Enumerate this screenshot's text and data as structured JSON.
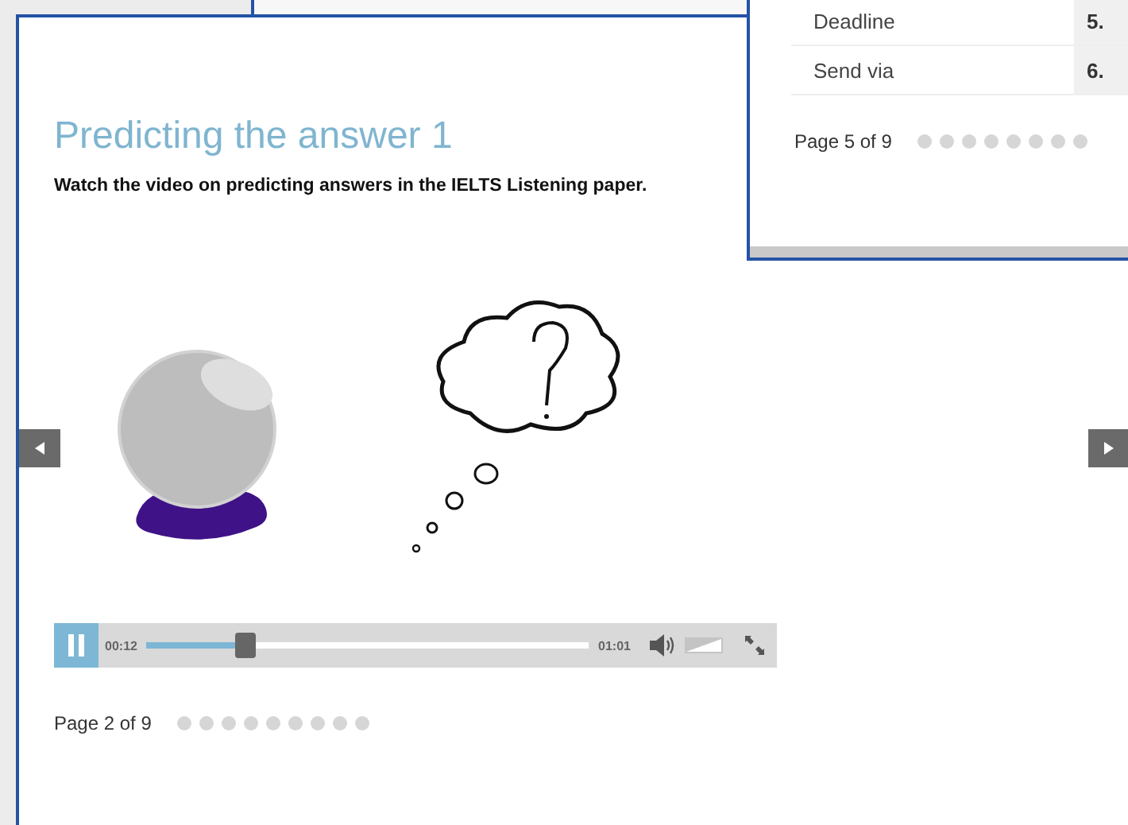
{
  "main_window": {
    "title": "Predicting the answer 1",
    "instruction": "Watch the video on predicting answers in the IELTS Listening paper.",
    "video": {
      "playing": true,
      "elapsed": "00:12",
      "duration": "01:01",
      "level": 0.22,
      "volume": {
        "level": 1
      }
    },
    "page_indicator": "Page 2 of 9"
  },
  "side_window": {
    "rows": [
      {
        "label": "Deadline",
        "number": "5."
      },
      {
        "label": "Send via",
        "number": "6."
      }
    ],
    "page_indicator": "Page 5 of 9"
  }
}
